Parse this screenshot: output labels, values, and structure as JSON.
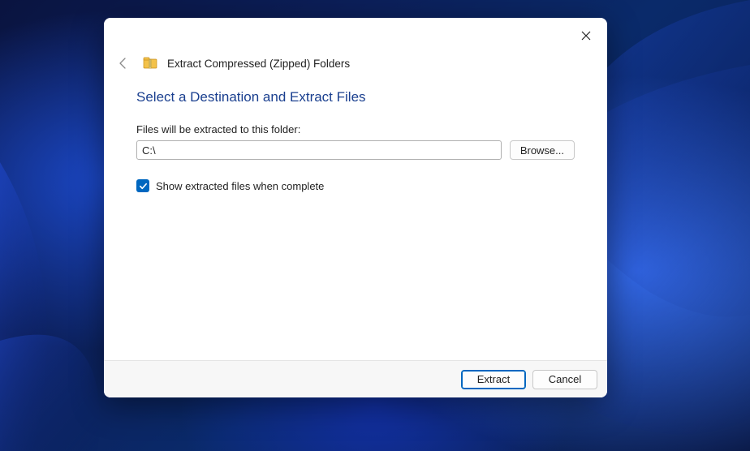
{
  "header": {
    "wizard_title": "Extract Compressed (Zipped) Folders"
  },
  "content": {
    "instruction": "Select a Destination and Extract Files",
    "field_label": "Files will be extracted to this folder:",
    "path_value": "C:\\",
    "browse_label": "Browse...",
    "checkbox_label": "Show extracted files when complete"
  },
  "footer": {
    "extract_label": "Extract",
    "cancel_label": "Cancel"
  }
}
